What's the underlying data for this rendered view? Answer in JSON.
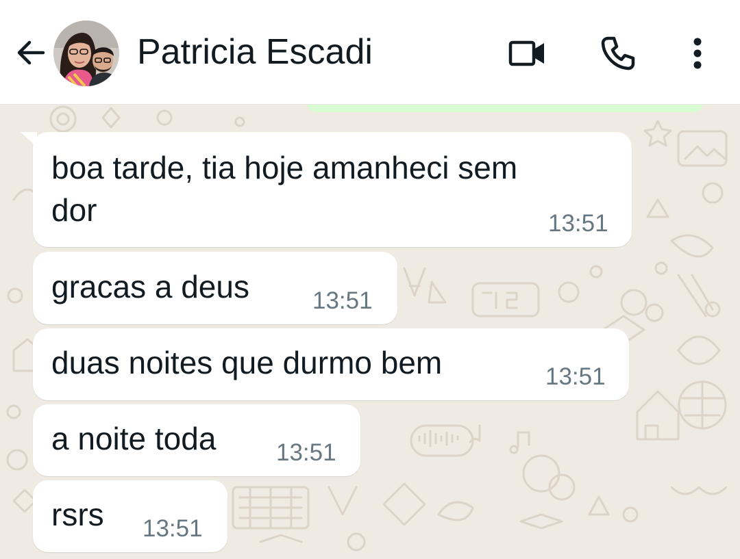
{
  "header": {
    "contact_name": "Patricia Escadi",
    "icons": {
      "back": "arrow-left-icon",
      "video": "video-camera-icon",
      "call": "phone-icon",
      "menu": "more-vert-icon"
    }
  },
  "messages": [
    {
      "lines": [
        "boa tarde, tia hoje amanheci sem",
        "dor"
      ],
      "time": "13:51",
      "direction": "incoming"
    },
    {
      "lines": [
        "gracas a deus"
      ],
      "time": "13:51",
      "direction": "incoming"
    },
    {
      "lines": [
        "duas noites que durmo bem"
      ],
      "time": "13:51",
      "direction": "incoming"
    },
    {
      "lines": [
        "a noite toda"
      ],
      "time": "13:51",
      "direction": "incoming"
    },
    {
      "lines": [
        "rsrs"
      ],
      "time": "13:51",
      "direction": "incoming"
    }
  ],
  "colors": {
    "chat_background": "#efeae2",
    "incoming_bubble": "#ffffff",
    "outgoing_bubble": "#d9fdd3",
    "timestamp": "#667781",
    "text": "#111b21"
  }
}
